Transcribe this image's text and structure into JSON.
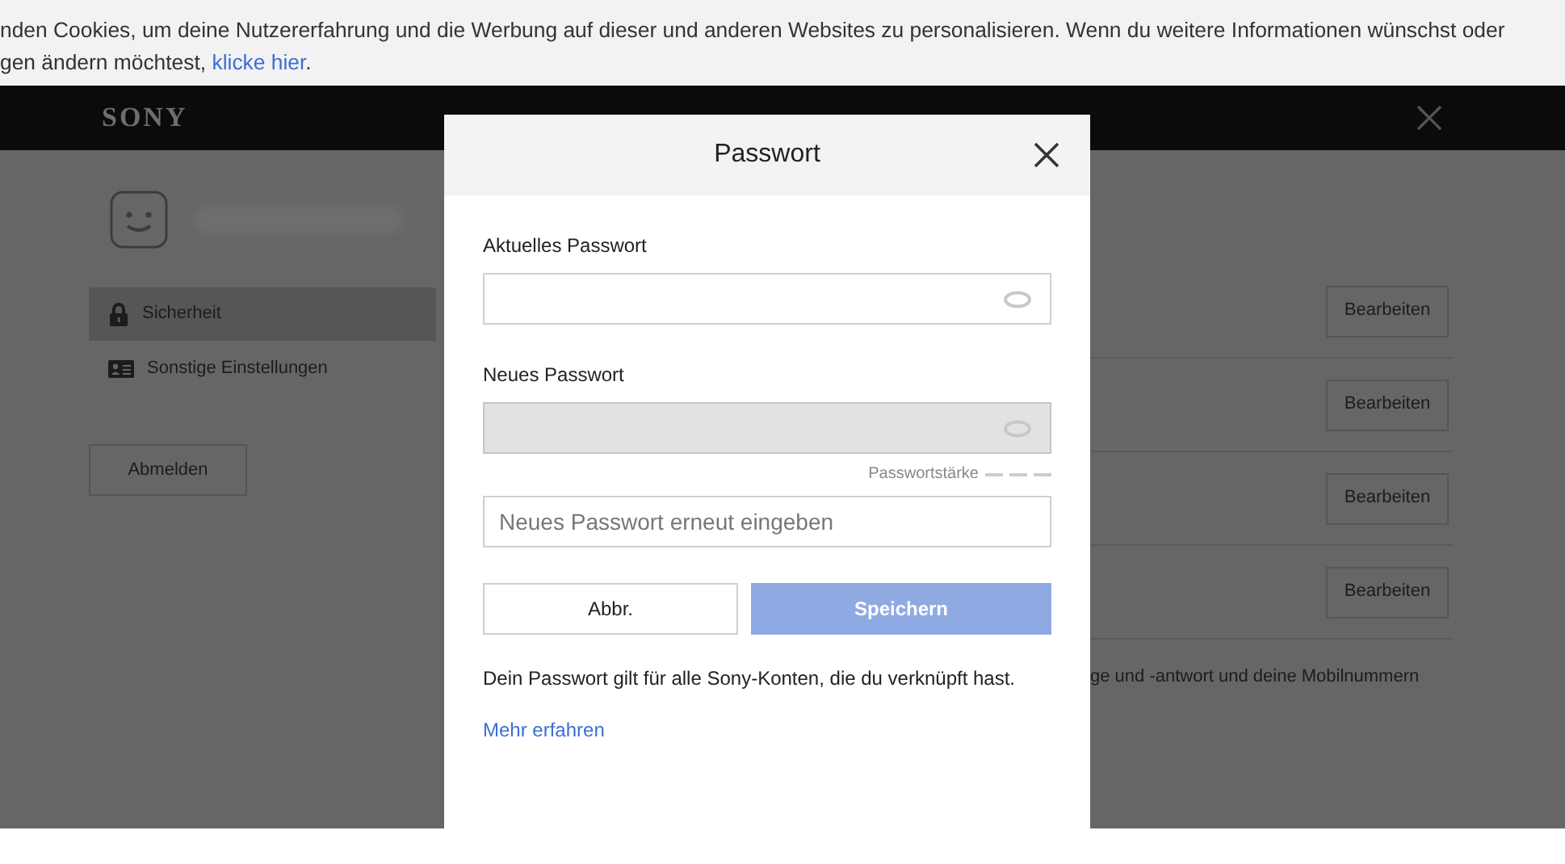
{
  "cookie_banner": {
    "line_1": "nden Cookies, um deine Nutzererfahrung und die Werbung auf dieser und anderen Websites zu personalisieren. Wenn du weitere Informationen wünschst oder",
    "line_2": "gen ändern möchtest,",
    "link": "klicke hier",
    "after_link": "."
  },
  "header": {
    "logo": "SONY"
  },
  "sidebar": {
    "items": [
      {
        "label": "Sicherheit",
        "selected": true
      },
      {
        "label": "Sonstige Einstellungen",
        "selected": false
      }
    ],
    "logout_button": "Abmelden"
  },
  "settings_rows": [
    {
      "button": "Bearbeiten"
    },
    {
      "button": "Bearbeiten"
    },
    {
      "button": "Bearbeiten"
    },
    {
      "button": "Bearbeiten"
    }
  ],
  "settings_note": "ge und -antwort und deine Mobilnummern",
  "dialog": {
    "title": "Passwort",
    "fields": [
      {
        "label": "Aktuelles Passwort",
        "disabled": false,
        "reveal": true
      },
      {
        "label": "Neues Passwort",
        "disabled": true,
        "reveal": true,
        "strength": {
          "label": "Passwortstärke"
        }
      },
      {
        "placeholder": "Neues Passwort erneut eingeben",
        "disabled": false,
        "reveal": false
      }
    ],
    "cancel_button": "Abbr.",
    "save_button": {
      "label": "Speichern",
      "disabled": true
    },
    "note": "Dein Passwort gilt für alle Sony-Konten, die du verknüpft hast.",
    "link": "Mehr erfahren"
  }
}
